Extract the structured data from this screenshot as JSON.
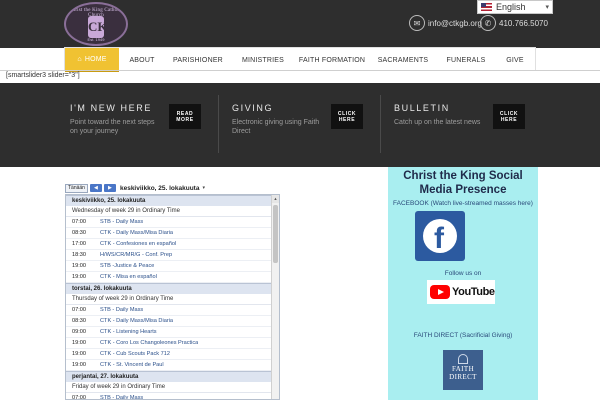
{
  "header": {
    "logo": {
      "top_text": "Christ the King Catholic Church",
      "bottom_text": "Est. 1949",
      "mark": "CK"
    },
    "language": {
      "selected": "English"
    },
    "email": {
      "icon": "envelope-icon",
      "text": "info@ctkgb.org"
    },
    "phone": {
      "icon": "phone-icon",
      "text": "410.766.5070"
    }
  },
  "nav": {
    "items": [
      {
        "label": "HOME",
        "active": true,
        "icon": "home-icon"
      },
      {
        "label": "ABOUT",
        "active": false
      },
      {
        "label": "PARISHIONER",
        "active": false
      },
      {
        "label": "MINISTRIES",
        "active": false
      },
      {
        "label": "FAITH FORMATION",
        "active": false
      },
      {
        "label": "SACRAMENTS",
        "active": false
      },
      {
        "label": "FUNERALS",
        "active": false
      },
      {
        "label": "GIVE",
        "active": false
      }
    ]
  },
  "shortcode": "[smartslider3 slider=\"3\"]",
  "promos": [
    {
      "title": "I'M NEW HERE",
      "subtitle": "Point toward the next steps on your journey",
      "button": "READ MORE"
    },
    {
      "title": "GIVING",
      "subtitle": "Electronic giving using Faith Direct",
      "button": "CLICK HERE"
    },
    {
      "title": "BULLETIN",
      "subtitle": "Catch up on the latest news",
      "button": "CLICK HERE"
    }
  ],
  "calendar": {
    "today_label": "Tänään",
    "prev_label": "◀",
    "next_label": "▶",
    "current_date": "keskiviikko, 25. lokakuuta",
    "days": [
      {
        "heading": "keskiviikko, 25. lokakuuta",
        "week": "Wednesday of week 29 in Ordinary Time",
        "events": [
          {
            "time": "07:00",
            "title": "STB - Daily Mass"
          },
          {
            "time": "08:30",
            "title": "CTK - Daily Mass/Misa Diaria"
          },
          {
            "time": "17:00",
            "title": "CTK - Confesiones en español"
          },
          {
            "time": "18:30",
            "title": "H/WS/CR/MR/G - Conf. Prep"
          },
          {
            "time": "19:00",
            "title": "STB -Justice & Peace"
          },
          {
            "time": "19:00",
            "title": "CTK - Misa en español"
          }
        ]
      },
      {
        "heading": "torstai, 26. lokakuuta",
        "week": "Thursday of week 29 in Ordinary Time",
        "events": [
          {
            "time": "07:00",
            "title": "STB - Daily Mass"
          },
          {
            "time": "08:30",
            "title": "CTK - Daily Mass/Misa Diaria"
          },
          {
            "time": "09:00",
            "title": "CTK - Listening Hearts"
          },
          {
            "time": "19:00",
            "title": "CTK - Coro Los Changoleones Practica"
          },
          {
            "time": "19:00",
            "title": "CTK - Cub Scouts Pack 712"
          },
          {
            "time": "19:00",
            "title": "CTK - St. Vincent de Paul"
          }
        ]
      },
      {
        "heading": "perjantai, 27. lokakuuta",
        "week": "Friday of week 29 in Ordinary Time",
        "events": [
          {
            "time": "07:00",
            "title": "STB - Daily Mass"
          }
        ]
      }
    ]
  },
  "social": {
    "title": "Christ the King Social Media Presence",
    "facebook_caption": "FACEBOOK (Watch live-streamed masses here)",
    "facebook_icon": "facebook-logo-icon",
    "follow_caption": "Follow us on",
    "youtube_word": "YouTube",
    "faith_caption": "FAITH DIRECT (Sacrificial Giving)",
    "faith_logo": {
      "line1": "FAITH",
      "line2": "DIRECT"
    }
  },
  "colors": {
    "header_bg": "#2e2e2e",
    "nav_active": "#f0c232",
    "social_bg": "#a9eef0",
    "facebook_blue": "#2c5aa0",
    "youtube_red": "#ff0000",
    "event_link": "#2a4f8a"
  }
}
